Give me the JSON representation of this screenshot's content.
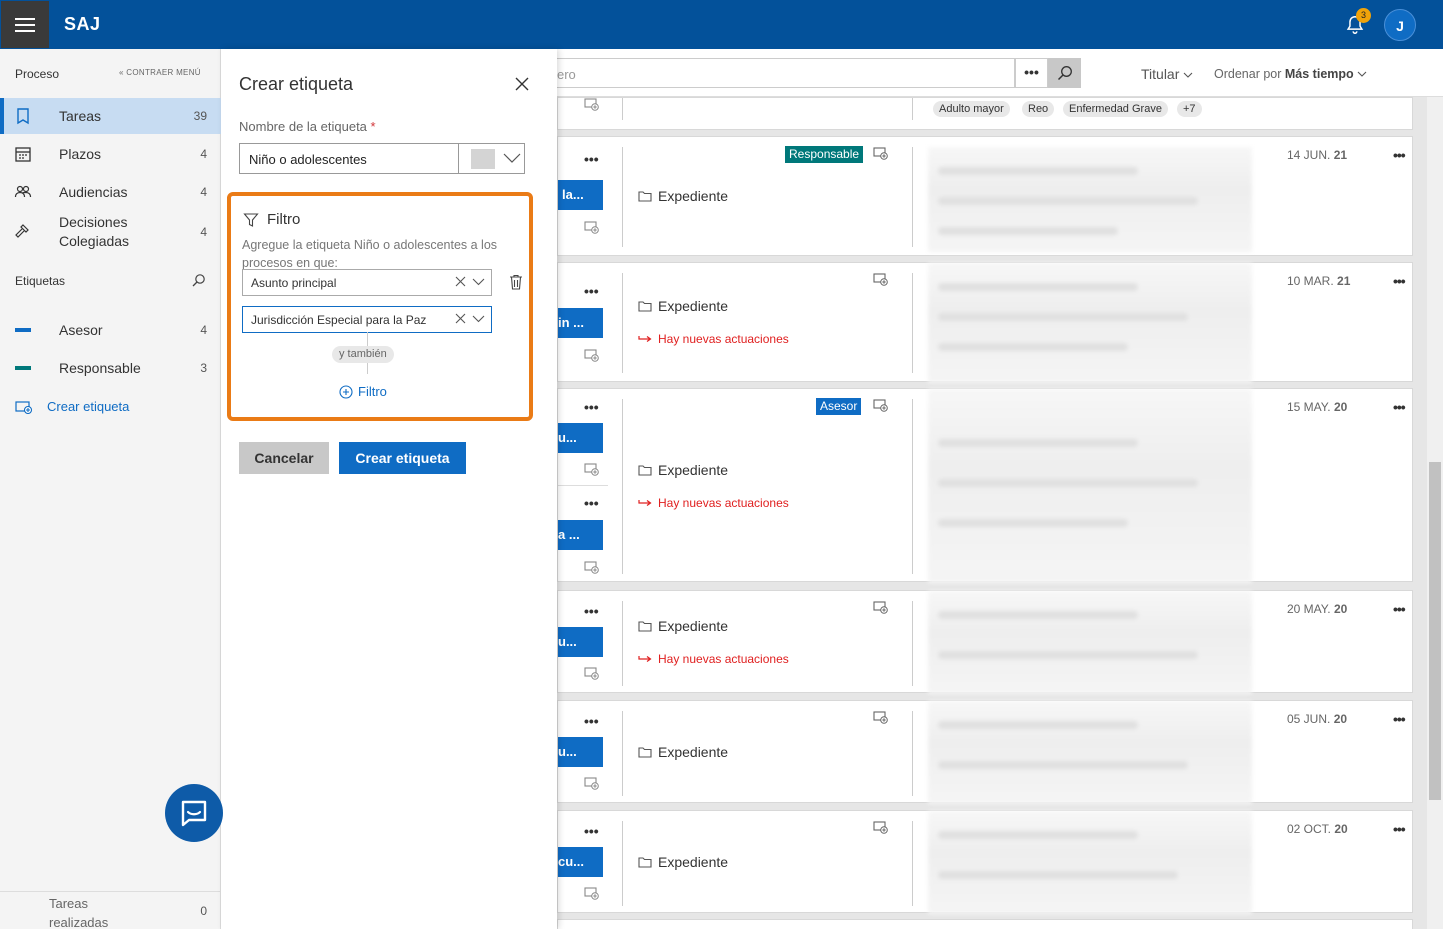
{
  "app": {
    "title": "SAJ",
    "notifications": "3",
    "user_initial": "J"
  },
  "sidebar": {
    "header": "Proceso",
    "collapse": "CONTRAER MENÚ",
    "items": [
      {
        "label": "Tareas",
        "count": "39"
      },
      {
        "label": "Plazos",
        "count": "4"
      },
      {
        "label": "Audiencias",
        "count": "4"
      },
      {
        "label": "Decisiones",
        "label2": "Colegiadas",
        "count": "4"
      }
    ],
    "tags_header": "Etiquetas",
    "tags": [
      {
        "label": "Asesor",
        "count": "4",
        "color": "#0f6cc4"
      },
      {
        "label": "Responsable",
        "count": "3",
        "color": "#00787a"
      }
    ],
    "create_tag": "Crear etiqueta",
    "done": {
      "label1": "Tareas",
      "label2": "realizadas",
      "count": "0"
    }
  },
  "panel": {
    "title": "Crear etiqueta",
    "name_label": "Nombre de la etiqueta",
    "required": "*",
    "name_value": "Niño o adolescentes",
    "filter_title": "Filtro",
    "filter_desc": "Agregue la etiqueta Niño o adolescentes a los procesos en que:",
    "filter1": "Asunto principal",
    "filter2": "Jurisdicción Especial para la Paz",
    "and_also": "y también",
    "add_filter": "Filtro",
    "cancel": "Cancelar",
    "create": "Crear etiqueta"
  },
  "toolbar": {
    "search_placeholder": "ero",
    "more": "•••",
    "titular": "Titular",
    "order_prefix": "Ordenar por",
    "order_value": "Más tiempo"
  },
  "top_chips": [
    "Adulto mayor",
    "Reo",
    "Enfermedad Grave",
    "+7"
  ],
  "cards": [
    {
      "btn": "la...",
      "tag": "Responsable",
      "tag_color": "#00787a",
      "exp": "Expediente",
      "news": "",
      "date": "14 JUN.",
      "year": "21"
    },
    {
      "btn": "in ...",
      "tag": "",
      "exp": "Expediente",
      "news": "Hay nuevas actuaciones",
      "date": "10 MAR.",
      "year": "21"
    },
    {
      "btn": "u...",
      "btn2": "a ...",
      "tag": "Asesor",
      "tag_color": "#0f6cc4",
      "exp": "Expediente",
      "news": "Hay nuevas actuaciones",
      "date": "15 MAY.",
      "year": "20"
    },
    {
      "btn": "u...",
      "tag": "",
      "exp": "Expediente",
      "news": "Hay nuevas actuaciones",
      "date": "20 MAY.",
      "year": "20"
    },
    {
      "btn": "u...",
      "tag": "",
      "exp": "Expediente",
      "news": "",
      "date": "05 JUN.",
      "year": "20"
    },
    {
      "btn": "cu...",
      "tag": "",
      "exp": "Expediente",
      "news": "",
      "date": "02 OCT.",
      "year": "20"
    }
  ]
}
